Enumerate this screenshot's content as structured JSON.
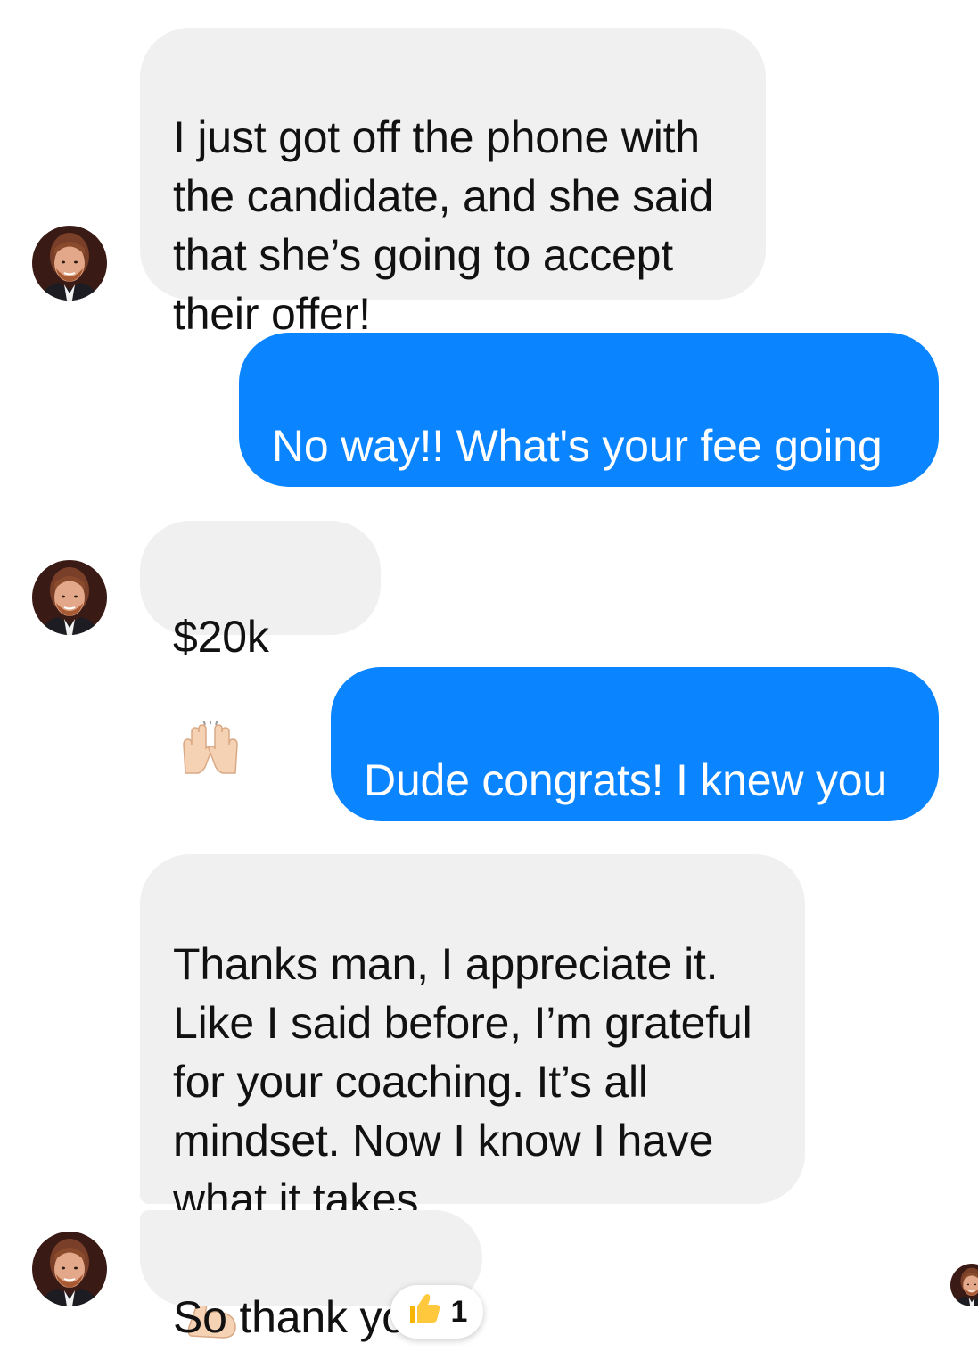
{
  "conversation": {
    "messages": [
      {
        "sender": "contact",
        "text": "I just got off the phone with\nthe candidate, and she said\nthat she’s going to accept\ntheir offer!"
      },
      {
        "sender": "me",
        "text": "No way!! What's your fee going\nto be on it??"
      },
      {
        "sender": "contact",
        "text": "$20k",
        "emoji": "raising-hands-emoji"
      },
      {
        "sender": "me",
        "text": "Dude congrats! I knew you\ncould do it!"
      },
      {
        "sender": "contact",
        "text": "Thanks man, I appreciate it.\nLike I said before, I’m grateful\nfor your coaching. It’s all\nmindset. Now I know I have\nwhat it takes",
        "emoji": "flexed-biceps-emoji"
      },
      {
        "sender": "contact",
        "text": "So thank you!",
        "reaction": {
          "icon": "thumbs-up-icon",
          "count": "1"
        }
      }
    ]
  },
  "colors": {
    "incoming_bubble": "#f0f0f0",
    "outgoing_bubble": "#0a84ff",
    "outgoing_text": "#ffffff",
    "incoming_text": "#111111"
  }
}
